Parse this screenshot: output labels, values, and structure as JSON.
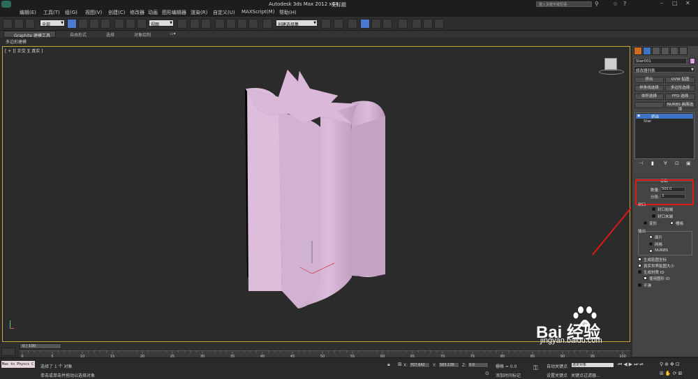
{
  "title": {
    "app": "Autodesk 3ds Max  2012 x64",
    "doc": "无标题",
    "search_placeholder": "键入关键字或短语"
  },
  "menu": [
    "编辑(E)",
    "工具(T)",
    "组(G)",
    "视图(V)",
    "创建(C)",
    "修改器",
    "动画",
    "图形编辑器",
    "渲染(R)",
    "自定义(U)",
    "MAXScript(M)",
    "帮助(H)"
  ],
  "toolbar": {
    "selection_filter": "全部",
    "ref_coord": "视图",
    "named_sel": "创建选择集"
  },
  "ribbon": {
    "tabs": [
      "Graphite 建模工具",
      "自由形式",
      "选择",
      "对象绘制"
    ],
    "sub": "多边形建模"
  },
  "viewport": {
    "label": "[ + ][ 正交 ][ 真实 ]"
  },
  "panel": {
    "object_name": "Star001",
    "modifier_list": "修改器列表",
    "buttons": [
      "挤出",
      "UVW 贴图",
      "样条线选择",
      "多边形选择",
      "体积选择",
      "FFD 选择",
      "",
      "NURBS 曲面选择"
    ],
    "stack": [
      "挤出",
      "Star"
    ],
    "params_title": "参数",
    "amount_label": "数量:",
    "amount_value": "500.0",
    "segments_label": "分段:",
    "segments_value": "3",
    "capping_title": "封口",
    "cap_start": "封口始端",
    "cap_end": "封口末端",
    "morph": "变形",
    "grid": "栅格",
    "output_title": "输出",
    "out_patch": "面片",
    "out_mesh": "网格",
    "out_nurbs": "NURBS",
    "gen_map": "生成贴图坐标",
    "real_world": "真实世界贴图大小",
    "gen_mat": "生成材质 ID",
    "use_shape": "使用图形 ID",
    "smooth": "平滑"
  },
  "timeline": {
    "frame": "0 / 100",
    "ticks": [
      "0",
      "5",
      "10",
      "15",
      "20",
      "25",
      "30",
      "35",
      "40",
      "45",
      "50",
      "55",
      "60",
      "65",
      "70",
      "75",
      "80",
      "85",
      "90",
      "95",
      "100"
    ]
  },
  "status": {
    "maxscript": "Max to Physcs C",
    "selected": "选择了 1 个 对象",
    "hint": "单击或单击并拖动以选择对象",
    "x_label": "X:",
    "x": "707.642",
    "y_label": "Y:",
    "y": "583.138",
    "z_label": "Z:",
    "z": "0.0",
    "grid": "栅格 = 0.0",
    "add_time_tag": "添加时间标记",
    "auto_key": "自动关键点",
    "set_key": "设置关键点",
    "sel_obj": "选定对象",
    "key_filters": "关键点过滤器..."
  },
  "watermark": {
    "brand": "Bai 经验",
    "url": "jingyan.baidu.com"
  },
  "colors": {
    "object": "#d9b8d9",
    "highlight": "#e01818",
    "active_blue": "#4a7bd0",
    "viewport_border": "#c7a83a"
  }
}
